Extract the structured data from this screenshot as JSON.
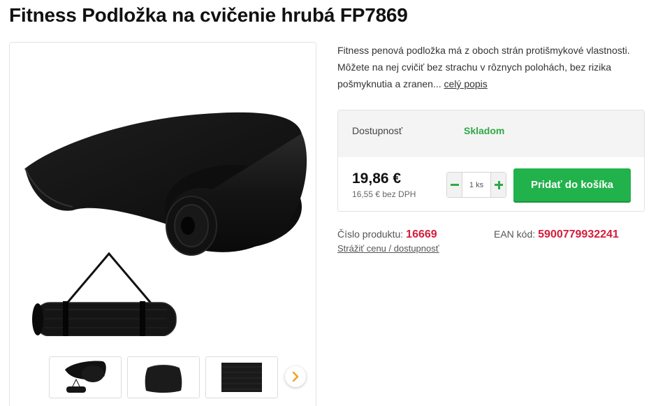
{
  "product": {
    "title": "Fitness Podložka na cvičenie hrubá FP7869",
    "description": "Fitness penová podložka má z oboch strán protišmykové vlastnosti. Môžete na nej cvičiť bez strachu v rôznych polohách, bez rizika pošmyknutia a zranen...",
    "full_description_link": "celý popis",
    "image_alt": "black-yoga-mat"
  },
  "buybox": {
    "availability_label": "Dostupnosť",
    "availability_value": "Skladom",
    "price": "19,86 €",
    "price_without_vat": "16,55 € bez DPH",
    "quantity_value": "1 ks",
    "add_to_cart_label": "Pridať do košíka"
  },
  "meta": {
    "product_number_label": "Číslo produktu:",
    "product_number": "16669",
    "ean_label": "EAN kód:",
    "ean": "5900779932241",
    "watch_price_link": "Strážiť cenu / dostupnosť"
  },
  "colors": {
    "accent_green": "#22b24c",
    "stock_green": "#2eaa47",
    "highlight_red": "#d61c3c"
  },
  "icons": {
    "gallery_next": "chevron-right-icon",
    "qty_minus": "minus-icon",
    "qty_plus": "plus-icon"
  }
}
